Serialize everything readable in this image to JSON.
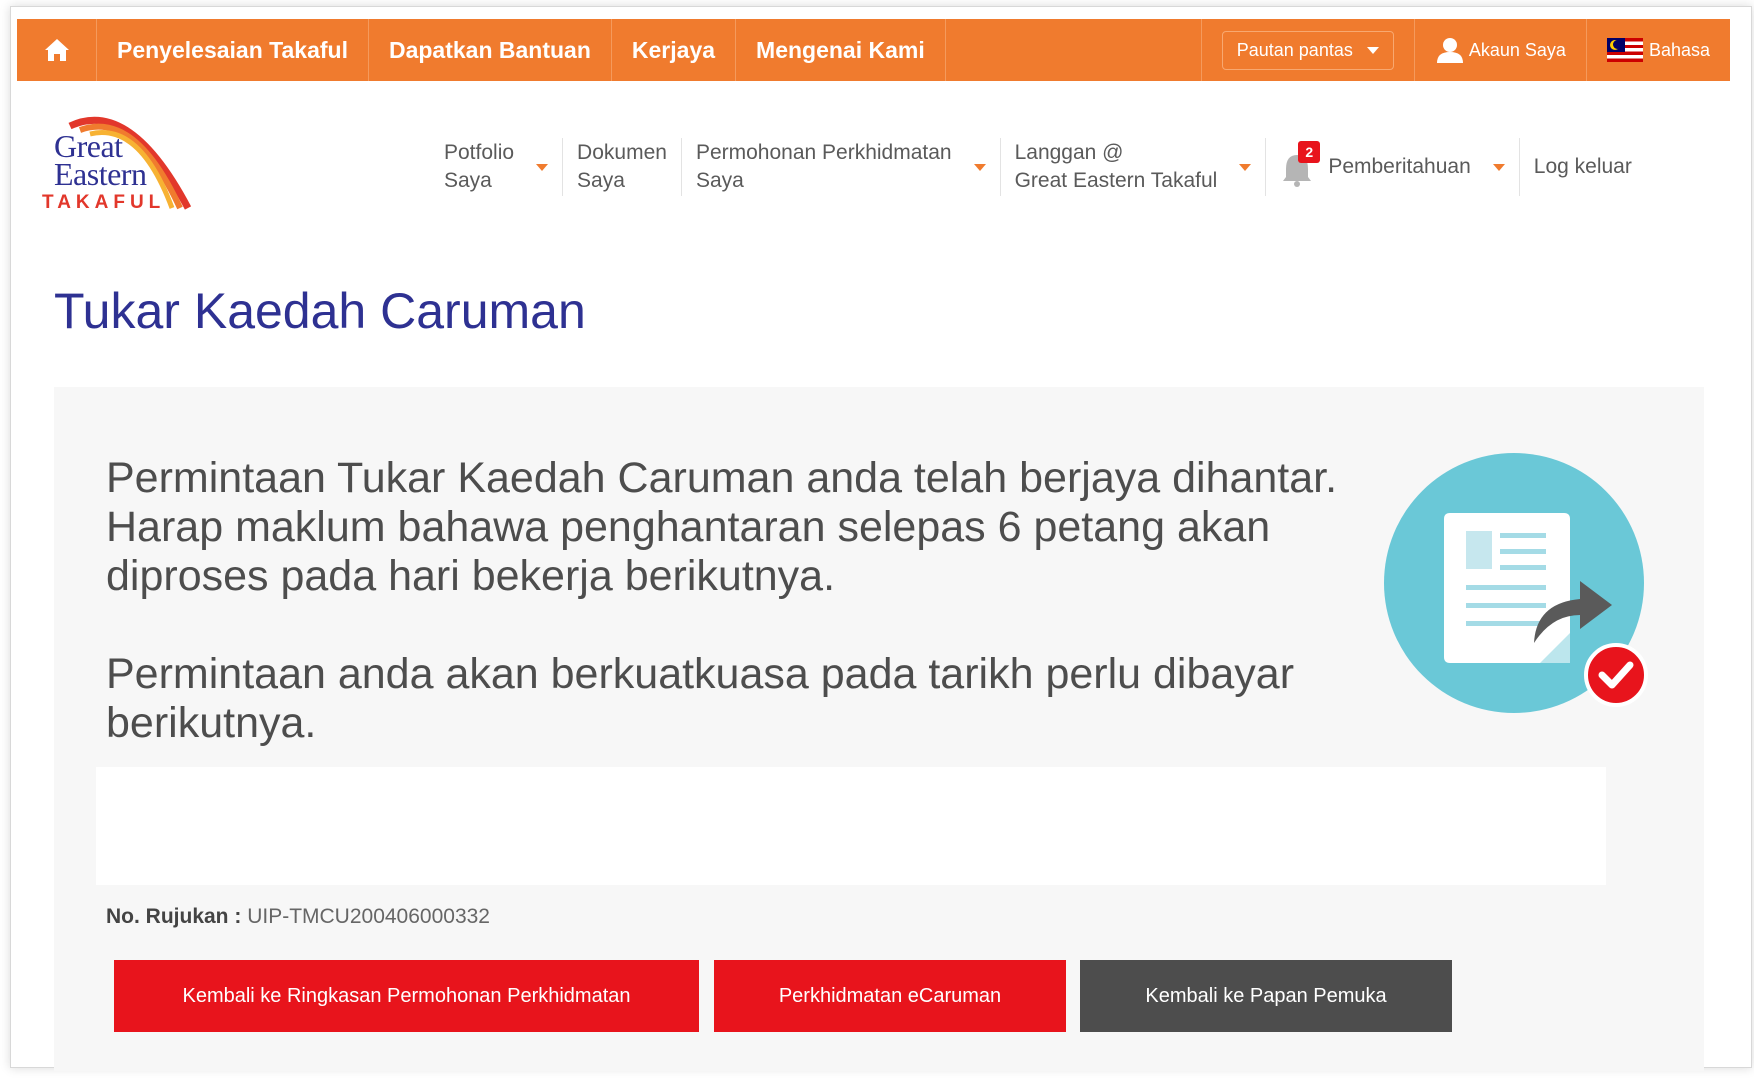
{
  "topnav": {
    "items": [
      "Penyelesaian Takaful",
      "Dapatkan Bantuan",
      "Kerjaya",
      "Mengenai Kami"
    ],
    "quick_links": "Pautan pantas",
    "account": "Akaun Saya",
    "language": "Bahasa"
  },
  "logo": {
    "line1": "Great",
    "line2": "Eastern",
    "line3": "TAKAFUL"
  },
  "subnav": {
    "portfolio": [
      "Potfolio",
      "Saya"
    ],
    "documents": [
      "Dokumen",
      "Saya"
    ],
    "service_requests": [
      "Permohonan Perkhidmatan",
      "Saya"
    ],
    "subscribe": [
      "Langgan @",
      "Great Eastern Takaful"
    ],
    "notifications": "Pemberitahuan",
    "notification_count": "2",
    "logout": "Log keluar"
  },
  "page_title": "Tukar Kaedah Caruman",
  "message": {
    "paragraph1": "Permintaan Tukar Kaedah Caruman anda telah berjaya dihantar. Harap maklum bahawa penghantaran selepas 6 petang akan diproses pada hari bekerja berikutnya.",
    "paragraph2": "Permintaan anda akan berkuatkuasa pada tarikh perlu dibayar berikutnya."
  },
  "reference": {
    "label": "No. Rujukan :",
    "value": "UIP-TMCU200406000332"
  },
  "buttons": {
    "back_summary": "Kembali ke Ringkasan Permohonan Perkhidmatan",
    "ecaruman": "Perkhidmatan eCaruman",
    "back_home": "Kembali ke Papan Pemuka"
  },
  "colors": {
    "brand_orange": "#f07b2e",
    "title_blue": "#2e3192",
    "button_red": "#e8141c",
    "button_dark": "#4d4d4d",
    "illustration_teal": "#6ac8d7"
  },
  "icons": [
    "home-icon",
    "user-icon",
    "malaysia-flag-icon",
    "bell-icon",
    "document-share-icon",
    "check-icon"
  ]
}
